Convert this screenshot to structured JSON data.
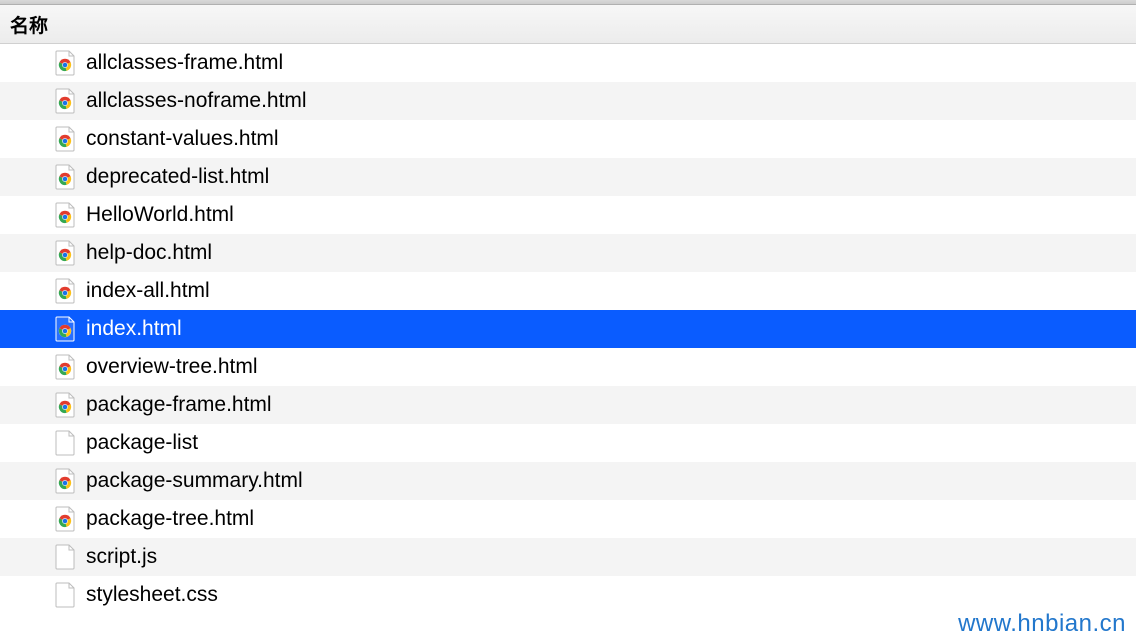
{
  "header": {
    "column_label": "名称"
  },
  "files": [
    {
      "name": "allclasses-frame.html",
      "type": "html",
      "selected": false
    },
    {
      "name": "allclasses-noframe.html",
      "type": "html",
      "selected": false
    },
    {
      "name": "constant-values.html",
      "type": "html",
      "selected": false
    },
    {
      "name": "deprecated-list.html",
      "type": "html",
      "selected": false
    },
    {
      "name": "HelloWorld.html",
      "type": "html",
      "selected": false
    },
    {
      "name": "help-doc.html",
      "type": "html",
      "selected": false
    },
    {
      "name": "index-all.html",
      "type": "html",
      "selected": false
    },
    {
      "name": "index.html",
      "type": "html",
      "selected": true
    },
    {
      "name": "overview-tree.html",
      "type": "html",
      "selected": false
    },
    {
      "name": "package-frame.html",
      "type": "html",
      "selected": false
    },
    {
      "name": "package-list",
      "type": "doc",
      "selected": false
    },
    {
      "name": "package-summary.html",
      "type": "html",
      "selected": false
    },
    {
      "name": "package-tree.html",
      "type": "html",
      "selected": false
    },
    {
      "name": "script.js",
      "type": "doc",
      "selected": false
    },
    {
      "name": "stylesheet.css",
      "type": "doc",
      "selected": false
    }
  ],
  "watermark": "www.hnbian.cn",
  "icons": {
    "html": "chrome-html-icon",
    "doc": "generic-file-icon"
  }
}
